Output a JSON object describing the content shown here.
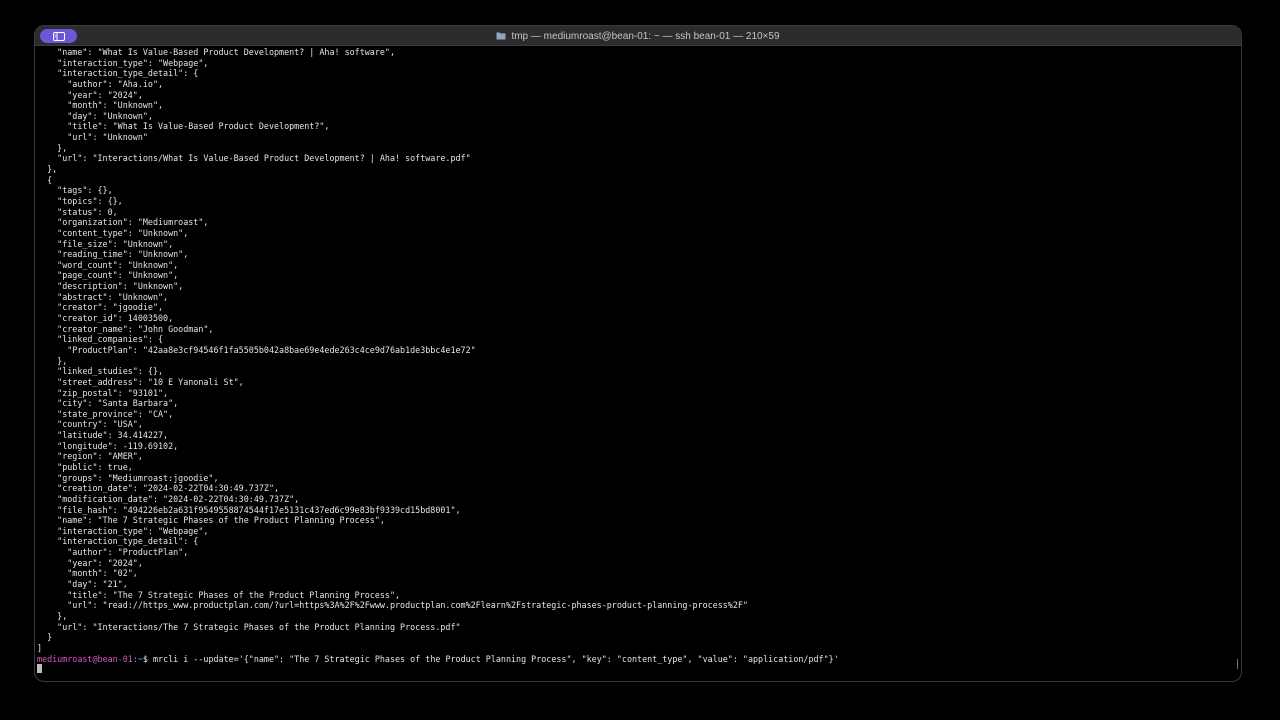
{
  "window": {
    "title": "tmp — mediumroast@bean-01: ~ — ssh bean-01 — 210×59"
  },
  "terminal": {
    "lines": [
      "    \"name\": \"What Is Value-Based Product Development? | Aha! software\",",
      "    \"interaction_type\": \"Webpage\",",
      "    \"interaction_type_detail\": {",
      "      \"author\": \"Aha.io\",",
      "      \"year\": \"2024\",",
      "      \"month\": \"Unknown\",",
      "      \"day\": \"Unknown\",",
      "      \"title\": \"What Is Value-Based Product Development?\",",
      "      \"url\": \"Unknown\"",
      "    },",
      "    \"url\": \"Interactions/What Is Value-Based Product Development? | Aha! software.pdf\"",
      "  },",
      "  {",
      "    \"tags\": {},",
      "    \"topics\": {},",
      "    \"status\": 0,",
      "    \"organization\": \"Mediumroast\",",
      "    \"content_type\": \"Unknown\",",
      "    \"file_size\": \"Unknown\",",
      "    \"reading_time\": \"Unknown\",",
      "    \"word_count\": \"Unknown\",",
      "    \"page_count\": \"Unknown\",",
      "    \"description\": \"Unknown\",",
      "    \"abstract\": \"Unknown\",",
      "    \"creator\": \"jgoodie\",",
      "    \"creator_id\": 14003500,",
      "    \"creator_name\": \"John Goodman\",",
      "    \"linked_companies\": {",
      "      \"ProductPlan\": \"42aa8e3cf94546f1fa5505b042a8bae69e4ede263c4ce9d76ab1de3bbc4e1e72\"",
      "    },",
      "    \"linked_studies\": {},",
      "    \"street_address\": \"10 E Yanonali St\",",
      "    \"zip_postal\": \"93101\",",
      "    \"city\": \"Santa Barbara\",",
      "    \"state_province\": \"CA\",",
      "    \"country\": \"USA\",",
      "    \"latitude\": 34.414227,",
      "    \"longitude\": -119.69102,",
      "    \"region\": \"AMER\",",
      "    \"public\": true,",
      "    \"groups\": \"Mediumroast:jgoodie\",",
      "    \"creation_date\": \"2024-02-22T04:30:49.737Z\",",
      "    \"modification_date\": \"2024-02-22T04:30:49.737Z\",",
      "    \"file_hash\": \"494226eb2a631f9549558874544f17e5131c437ed6c99e83bf9339cd15bd8001\",",
      "    \"name\": \"The 7 Strategic Phases of the Product Planning Process\",",
      "    \"interaction_type\": \"Webpage\",",
      "    \"interaction_type_detail\": {",
      "      \"author\": \"ProductPlan\",",
      "      \"year\": \"2024\",",
      "      \"month\": \"02\",",
      "      \"day\": \"21\",",
      "      \"title\": \"The 7 Strategic Phases of the Product Planning Process\",",
      "      \"url\": \"read://https_www.productplan.com/?url=https%3A%2F%2Fwww.productplan.com%2Flearn%2Fstrategic-phases-product-planning-process%2F\"",
      "    },",
      "    \"url\": \"Interactions/The 7 Strategic Phases of the Product Planning Process.pdf\"",
      "  }",
      "]"
    ],
    "prompt_user": "mediumroast@bean-01",
    "prompt_path": ":~",
    "prompt_symbol": "$",
    "command": " mrcli i --update='{\"name\": \"The 7 Strategic Phases of the Product Planning Process\", \"key\": \"content_type\", \"value\": \"application/pdf\"}'"
  }
}
